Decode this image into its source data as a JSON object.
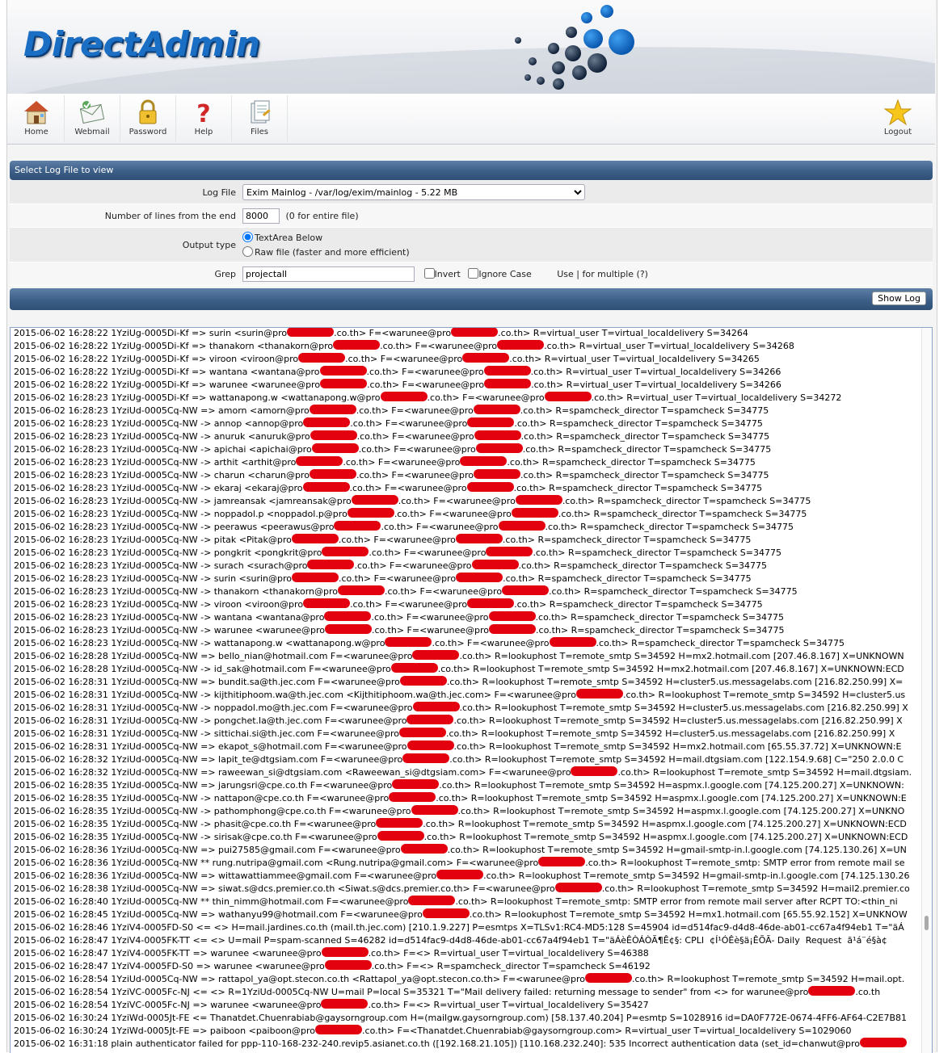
{
  "brand": {
    "logo_text": "DirectAdmin",
    "accent": "#1a6fc4",
    "bar_color": "#3c5f88"
  },
  "toolbar": {
    "items": [
      {
        "label": "Home",
        "icon": "house-icon"
      },
      {
        "label": "Webmail",
        "icon": "mail-icon"
      },
      {
        "label": "Password",
        "icon": "lock-icon"
      },
      {
        "label": "Help",
        "icon": "question-icon"
      },
      {
        "label": "Files",
        "icon": "files-icon"
      }
    ],
    "logout": {
      "label": "Logout",
      "icon": "star-icon"
    }
  },
  "form": {
    "header": "Select Log File to view",
    "log_file_label": "Log File",
    "log_file_value": "Exim Mainlog - /var/log/exim/mainlog - 5.22 MB",
    "lines_label": "Number of lines from the end",
    "lines_value": "8000",
    "lines_hint": "(0 for entire file)",
    "output_label": "Output type",
    "output_options": [
      "TextArea Below",
      "Raw file (faster and more efficient)"
    ],
    "output_selected": "TextArea Below",
    "grep_label": "Grep",
    "grep_value": "projectall",
    "invert_label": "Invert",
    "ignore_case_label": "Ignore Case",
    "grep_hint": "Use | for multiple (?)",
    "show_log_label": "Show Log"
  },
  "log": {
    "lines": [
      [
        "2015-06-02 16:28:22 1YziUg-0005Di-Kf => surin <surin@pro",
        "",
        ".co.th> F=<warunee@pro",
        "",
        ".co.th> R=virtual_user T=virtual_localdelivery S=34264"
      ],
      [
        "2015-06-02 16:28:22 1YziUg-0005Di-Kf => thanakorn <thanakorn@pro",
        "",
        ".co.th> F=<warunee@pro",
        "",
        ".co.th> R=virtual_user T=virtual_localdelivery S=34268"
      ],
      [
        "2015-06-02 16:28:22 1YziUg-0005Di-Kf => viroon <viroon@pro",
        "",
        ".co.th> F=<warunee@pro",
        "",
        ".co.th> R=virtual_user T=virtual_localdelivery S=34265"
      ],
      [
        "2015-06-02 16:28:22 1YziUg-0005Di-Kf => wantana <wantana@pro",
        "",
        ".co.th> F=<warunee@pro",
        "",
        ".co.th> R=virtual_user T=virtual_localdelivery S=34266"
      ],
      [
        "2015-06-02 16:28:22 1YziUg-0005Di-Kf => warunee <warunee@pro",
        "",
        ".co.th> F=<warunee@pro",
        "",
        ".co.th> R=virtual_user T=virtual_localdelivery S=34266"
      ],
      [
        "2015-06-02 16:28:23 1YziUg-0005Di-Kf => wattanapong.w <wattanapong.w@pro",
        "",
        ".co.th> F=<warunee@pro",
        "",
        ".co.th> R=virtual_user T=virtual_localdelivery S=34272"
      ],
      [
        "2015-06-02 16:28:23 1YziUd-0005Cq-NW => amorn <amorn@pro",
        "",
        ".co.th> F=<warunee@pro",
        "",
        ".co.th> R=spamcheck_director T=spamcheck S=34775"
      ],
      [
        "2015-06-02 16:28:23 1YziUd-0005Cq-NW -> annop <annop@pro",
        "",
        ".co.th> F=<warunee@pro",
        "",
        ".co.th> R=spamcheck_director T=spamcheck S=34775"
      ],
      [
        "2015-06-02 16:28:23 1YziUd-0005Cq-NW -> anuruk <anuruk@pro",
        "",
        ".co.th> F=<warunee@pro",
        "",
        ".co.th> R=spamcheck_director T=spamcheck S=34775"
      ],
      [
        "2015-06-02 16:28:23 1YziUd-0005Cq-NW -> apichai <apichai@pro",
        "",
        ".co.th> F=<warunee@pro",
        "",
        ".co.th> R=spamcheck_director T=spamcheck S=34775"
      ],
      [
        "2015-06-02 16:28:23 1YziUd-0005Cq-NW -> arthit <arthit@pro",
        "",
        ".co.th> F=<warunee@pro",
        "",
        ".co.th> R=spamcheck_director T=spamcheck S=34775"
      ],
      [
        "2015-06-02 16:28:23 1YziUd-0005Cq-NW -> charun <charun@pro",
        "",
        ".co.th> F=<warunee@pro",
        "",
        ".co.th> R=spamcheck_director T=spamcheck S=34775"
      ],
      [
        "2015-06-02 16:28:23 1YziUd-0005Cq-NW -> ekaraj <ekaraj@pro",
        "",
        ".co.th> F=<warunee@pro",
        "",
        ".co.th> R=spamcheck_director T=spamcheck S=34775"
      ],
      [
        "2015-06-02 16:28:23 1YziUd-0005Cq-NW -> jamreansak <jamreansak@pro",
        "",
        ".co.th> F=<warunee@pro",
        "",
        ".co.th> R=spamcheck_director T=spamcheck S=34775"
      ],
      [
        "2015-06-02 16:28:23 1YziUd-0005Cq-NW -> noppadol.p <noppadol.p@pro",
        "",
        ".co.th> F=<warunee@pro",
        "",
        ".co.th> R=spamcheck_director T=spamcheck S=34775"
      ],
      [
        "2015-06-02 16:28:23 1YziUd-0005Cq-NW -> peerawus <peerawus@pro",
        "",
        ".co.th> F=<warunee@pro",
        "",
        ".co.th> R=spamcheck_director T=spamcheck S=34775"
      ],
      [
        "2015-06-02 16:28:23 1YziUd-0005Cq-NW -> pitak <Pitak@pro",
        "",
        ".co.th> F=<warunee@pro",
        "",
        ".co.th> R=spamcheck_director T=spamcheck S=34775"
      ],
      [
        "2015-06-02 16:28:23 1YziUd-0005Cq-NW -> pongkrit <pongkrit@pro",
        "",
        ".co.th> F=<warunee@pro",
        "",
        ".co.th> R=spamcheck_director T=spamcheck S=34775"
      ],
      [
        "2015-06-02 16:28:23 1YziUd-0005Cq-NW -> surach <surach@pro",
        "",
        ".co.th> F=<warunee@pro",
        "",
        ".co.th> R=spamcheck_director T=spamcheck S=34775"
      ],
      [
        "2015-06-02 16:28:23 1YziUd-0005Cq-NW -> surin <surin@pro",
        "",
        ".co.th> F=<warunee@pro",
        "",
        ".co.th> R=spamcheck_director T=spamcheck S=34775"
      ],
      [
        "2015-06-02 16:28:23 1YziUd-0005Cq-NW -> thanakorn <thanakorn@pro",
        "",
        ".co.th> F=<warunee@pro",
        "",
        ".co.th> R=spamcheck_director T=spamcheck S=34775"
      ],
      [
        "2015-06-02 16:28:23 1YziUd-0005Cq-NW -> viroon <viroon@pro",
        "",
        ".co.th> F=<warunee@pro",
        "",
        ".co.th> R=spamcheck_director T=spamcheck S=34775"
      ],
      [
        "2015-06-02 16:28:23 1YziUd-0005Cq-NW -> wantana <wantana@pro",
        "",
        ".co.th> F=<warunee@pro",
        "",
        ".co.th> R=spamcheck_director T=spamcheck S=34775"
      ],
      [
        "2015-06-02 16:28:23 1YziUd-0005Cq-NW -> warunee <warunee@pro",
        "",
        ".co.th> F=<warunee@pro",
        "",
        ".co.th> R=spamcheck_director T=spamcheck S=34775"
      ],
      [
        "2015-06-02 16:28:23 1YziUd-0005Cq-NW -> wattanapong.w <wattanapong.w@pro",
        "",
        ".co.th> F=<warunee@pro",
        "",
        ".co.th> R=spamcheck_director T=spamcheck S=34775"
      ],
      [
        "2015-06-02 16:28:28 1YziUd-0005Cq-NW => bello_nian@hotmail.com F=<warunee@pro",
        "",
        ".co.th> R=lookuphost T=remote_smtp S=34592 H=mx2.hotmail.com [207.46.8.167] X=UNKNOWN"
      ],
      [
        "2015-06-02 16:28:28 1YziUd-0005Cq-NW -> id_sak@hotmail.com F=<warunee@pro",
        "",
        ".co.th> R=lookuphost T=remote_smtp S=34592 H=mx2.hotmail.com [207.46.8.167] X=UNKNOWN:ECD"
      ],
      [
        "2015-06-02 16:28:31 1YziUd-0005Cq-NW => bundit.sa@th.jec.com F=<warunee@pro",
        "",
        ".co.th> R=lookuphost T=remote_smtp S=34592 H=cluster5.us.messagelabs.com [216.82.250.99] X="
      ],
      [
        "2015-06-02 16:28:31 1YziUd-0005Cq-NW -> kijthitiphoom.wa@th.jec.com <Kijthitiphoom.wa@th.jec.com> F=<warunee@pro",
        "",
        ".co.th> R=lookuphost T=remote_smtp S=34592 H=cluster5.us"
      ],
      [
        "2015-06-02 16:28:31 1YziUd-0005Cq-NW -> noppadol.mo@th.jec.com F=<warunee@pro",
        "",
        ".co.th> R=lookuphost T=remote_smtp S=34592 H=cluster5.us.messagelabs.com [216.82.250.99] X"
      ],
      [
        "2015-06-02 16:28:31 1YziUd-0005Cq-NW -> pongchet.la@th.jec.com F=<warunee@pro",
        "",
        ".co.th> R=lookuphost T=remote_smtp S=34592 H=cluster5.us.messagelabs.com [216.82.250.99] X"
      ],
      [
        "2015-06-02 16:28:31 1YziUd-0005Cq-NW -> sittichai.si@th.jec.com F=<warunee@pro",
        "",
        ".co.th> R=lookuphost T=remote_smtp S=34592 H=cluster5.us.messagelabs.com [216.82.250.99] X"
      ],
      [
        "2015-06-02 16:28:31 1YziUd-0005Cq-NW => ekapot_s@hotmail.com F=<warunee@pro",
        "",
        ".co.th> R=lookuphost T=remote_smtp S=34592 H=mx2.hotmail.com [65.55.37.72] X=UNKNOWN:E"
      ],
      [
        "2015-06-02 16:28:32 1YziUd-0005Cq-NW => lapit_te@dtgsiam.com F=<warunee@pro",
        "",
        ".co.th> R=lookuphost T=remote_smtp S=34592 H=mail.dtgsiam.com [122.154.9.68] C=\"250 2.0.0 C"
      ],
      [
        "2015-06-02 16:28:32 1YziUd-0005Cq-NW => raweewan_si@dtgsiam.com <Raweewan_si@dtgsiam.com> F=<warunee@pro",
        "",
        ".co.th> R=lookuphost T=remote_smtp S=34592 H=mail.dtgsiam."
      ],
      [
        "2015-06-02 16:28:35 1YziUd-0005Cq-NW => jarungsri@cpe.co.th F=<warunee@pro",
        "",
        ".co.th> R=lookuphost T=remote_smtp S=34592 H=aspmx.l.google.com [74.125.200.27] X=UNKNOWN:"
      ],
      [
        "2015-06-02 16:28:35 1YziUd-0005Cq-NW -> nattapon@cpe.co.th F=<warunee@pro",
        "",
        ".co.th> R=lookuphost T=remote_smtp S=34592 H=aspmx.l.google.com [74.125.200.27] X=UNKNOWN:E"
      ],
      [
        "2015-06-02 16:28:35 1YziUd-0005Cq-NW -> pathomphong@cpe.co.th F=<warunee@pro",
        "",
        ".co.th> R=lookuphost T=remote_smtp S=34592 H=aspmx.l.google.com [74.125.200.27] X=UNKNO"
      ],
      [
        "2015-06-02 16:28:35 1YziUd-0005Cq-NW -> phasit@cpe.co.th F=<warunee@pro",
        "",
        ".co.th> R=lookuphost T=remote_smtp S=34592 H=aspmx.l.google.com [74.125.200.27] X=UNKNOWN:ECD"
      ],
      [
        "2015-06-02 16:28:35 1YziUd-0005Cq-NW -> sirisak@cpe.co.th F=<warunee@pro",
        "",
        ".co.th> R=lookuphost T=remote_smtp S=34592 H=aspmx.l.google.com [74.125.200.27] X=UNKNOWN:ECD"
      ],
      [
        "2015-06-02 16:28:36 1YziUd-0005Cq-NW => pui27585@gmail.com F=<warunee@pro",
        "",
        ".co.th> R=lookuphost T=remote_smtp S=34592 H=gmail-smtp-in.l.google.com [74.125.130.26] X=UN"
      ],
      [
        "2015-06-02 16:28:36 1YziUd-0005Cq-NW ** rung.nutripa@gmail.com <Rung.nutripa@gmail.com> F=<warunee@pro",
        "",
        ".co.th> R=lookuphost T=remote_smtp: SMTP error from remote mail se"
      ],
      [
        "2015-06-02 16:28:36 1YziUd-0005Cq-NW => wittawattiammee@gmail.com F=<warunee@pro",
        "",
        ".co.th> R=lookuphost T=remote_smtp S=34592 H=gmail-smtp-in.l.google.com [74.125.130.26"
      ],
      [
        "2015-06-02 16:28:38 1YziUd-0005Cq-NW => siwat.s@dcs.premier.co.th <Siwat.s@dcs.premier.co.th> F=<warunee@pro",
        "",
        ".co.th> R=lookuphost T=remote_smtp S=34592 H=mail2.premier.co"
      ],
      [
        "2015-06-02 16:28:40 1YziUd-0005Cq-NW ** thin_nimm@hotmail.com F=<warunee@pro",
        "",
        ".co.th> R=lookuphost T=remote_smtp: SMTP error from remote mail server after RCPT TO:<thin_ni"
      ],
      [
        "2015-06-02 16:28:45 1YziUd-0005Cq-NW => wathanyu99@hotmail.com F=<warunee@pro",
        "",
        ".co.th> R=lookuphost T=remote_smtp S=34592 H=mx1.hotmail.com [65.55.92.152] X=UNKNOW"
      ],
      [
        "2015-06-02 16:28:46 1YziV4-0005FD-S0 <= <> H=mail.jardines.co.th (mail.th.jec.com) [210.1.9.227] P=esmtps X=TLSv1:RC4-MD5:128 S=45904 id=d514fac9-d4d8-46de-ab01-cc67a4f94eb1 T=\"äÁ"
      ],
      [
        "2015-06-02 16:28:47 1YziV4-0005FK-TT <= <> U=mail P=spam-scanned S=46282 id=d514fac9-d4d8-46de-ab01-cc67a4f94eb1 T=\"äÁèÊÒÁÒÃ¶Ê¢§: CPLI  ¢Í¹ÓÊè§ä¡ÊÕÃ- Daily  Request  ã¹á¨é§à¢"
      ],
      [
        "2015-06-02 16:28:47 1YziV4-0005FK-TT => warunee <warunee@pro",
        "",
        ".co.th> F=<> R=virtual_user T=virtual_localdelivery S=46388"
      ],
      [
        "2015-06-02 16:28:47 1YziV4-0005FD-S0 => warunee <warunee@pro",
        "",
        ".co.th> F=<> R=spamcheck_director T=spamcheck S=46192"
      ],
      [
        "2015-06-02 16:28:54 1YziUd-0005Cq-NW => rattapol_ya@opt.stecon.co.th <Rattapol_ya@opt.stecon.co.th> F=<warunee@pro",
        "",
        ".co.th> R=lookuphost T=remote_smtp S=34592 H=mail.opt."
      ],
      [
        "2015-06-02 16:28:54 1YziVC-0005Fc-NJ <= <> R=1YziUd-0005Cq-NW U=mail P=local S=35321 T=\"Mail delivery failed: returning message to sender\" from <> for warunee@pro",
        "",
        ".co.th"
      ],
      [
        "2015-06-02 16:28:54 1YziVC-0005Fc-NJ => warunee <warunee@pro",
        "",
        ".co.th> F=<> R=virtual_user T=virtual_localdelivery S=35427"
      ],
      [
        "2015-06-02 16:30:24 1YziWd-0005Jt-FE <= Thanatdet.Chuenrabiab@gaysorngroup.com H=(mailgw.gaysorngroup.com) [58.137.40.204] P=esmtp S=1028916 id=DA0F772E-0674-4FF6-AF64-C2E7B81"
      ],
      [
        "2015-06-02 16:30:24 1YziWd-0005Jt-FE => paiboon <paiboon@pro",
        "",
        ".co.th> F=<Thanatdet.Chuenrabiab@gaysorngroup.com> R=virtual_user T=virtual_localdelivery S=1029060"
      ],
      [
        "2015-06-02 16:31:18 plain authenticator failed for ppp-110-168-232-240.revip5.asianet.co.th ([192.168.21.105]) [110.168.232.240]: 535 Incorrect authentication data (set_id=chanwut@pro",
        ""
      ]
    ]
  }
}
